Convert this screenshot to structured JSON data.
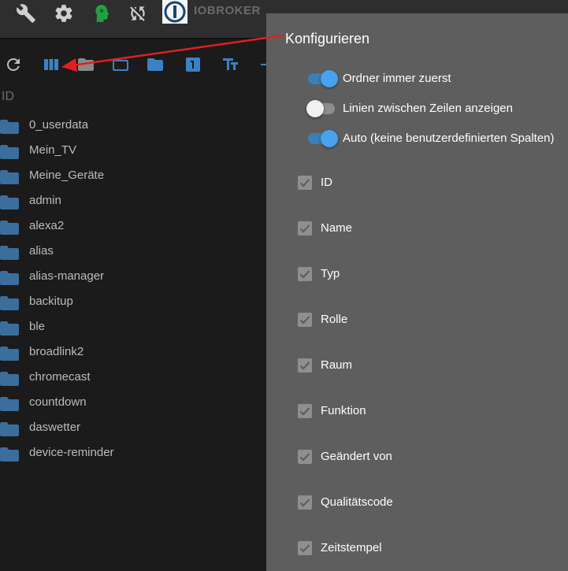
{
  "header": {
    "brand": "IOBROKER"
  },
  "list": {
    "id_header": "ID",
    "items": [
      "0_userdata",
      "Mein_TV",
      "Meine_Geräte",
      "admin",
      "alexa2",
      "alias",
      "alias-manager",
      "backitup",
      "ble",
      "broadlink2",
      "chromecast",
      "countdown",
      "daswetter",
      "device-reminder"
    ]
  },
  "panel": {
    "title": "Konfigurieren",
    "toggles": [
      {
        "label": "Ordner immer zuerst",
        "on": true
      },
      {
        "label": "Linien zwischen Zeilen anzeigen",
        "on": false
      },
      {
        "label": "Auto (keine benutzerdefinierten Spalten)",
        "on": true
      }
    ],
    "columns": [
      {
        "label": "ID",
        "checked": true
      },
      {
        "label": "Name",
        "checked": true
      },
      {
        "label": "Typ",
        "checked": true
      },
      {
        "label": "Rolle",
        "checked": true
      },
      {
        "label": "Raum",
        "checked": true
      },
      {
        "label": "Funktion",
        "checked": true
      },
      {
        "label": "Geändert von",
        "checked": true
      },
      {
        "label": "Qualitätscode",
        "checked": true
      },
      {
        "label": "Zeitstempel",
        "checked": true
      }
    ]
  },
  "colors": {
    "accent": "#48a2ee",
    "folder": "#3b6e9c",
    "annotation": "#e02020"
  }
}
